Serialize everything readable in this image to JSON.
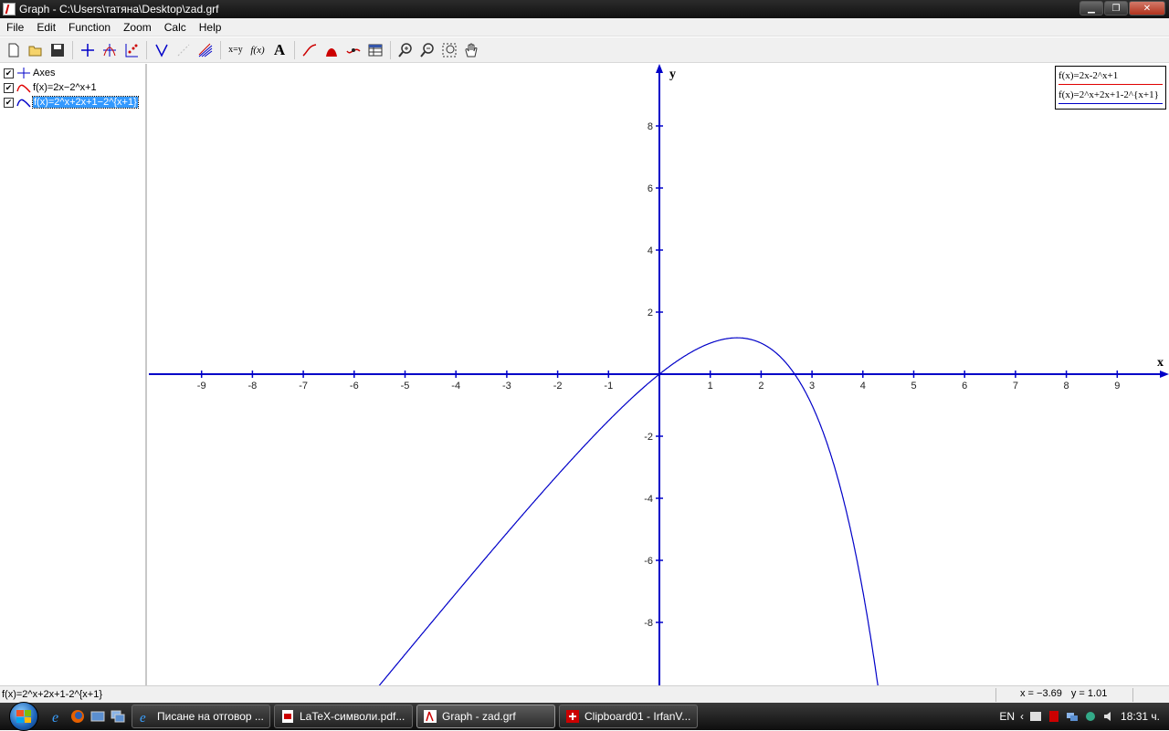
{
  "window": {
    "title": "Graph - C:\\Users\\татяна\\Desktop\\zad.grf",
    "buttons": [
      "minimize",
      "maximize",
      "close"
    ]
  },
  "menu": [
    "File",
    "Edit",
    "Function",
    "Zoom",
    "Calc",
    "Help"
  ],
  "toolbar": {
    "groups": [
      [
        "new-file-icon",
        "open-folder-icon",
        "save-disk-icon"
      ],
      [
        "axes-icon",
        "insert-function-icon",
        "insert-point-series-icon"
      ],
      [
        "tangent-icon",
        "relation-icon",
        "shading-icon"
      ],
      [
        "trendline-icon",
        "insert-label-icon",
        "text-icon"
      ],
      [
        "curve-icon",
        "area-icon",
        "evaluate-icon",
        "table-icon"
      ],
      [
        "zoom-in-icon",
        "zoom-out-icon",
        "zoom-window-icon",
        "pan-hand-icon"
      ]
    ],
    "text_buttons": {
      "xy": "x=y",
      "fx": "f(x)",
      "text": "A"
    }
  },
  "sidebar": {
    "items": [
      {
        "label": "Axes",
        "checked": true,
        "icon": "axes-icon",
        "selected": false
      },
      {
        "label": "f(x)=2x−2^x+1",
        "checked": true,
        "icon": "red-curve-icon",
        "color": "#e00000",
        "selected": false
      },
      {
        "label": "f(x)=2^x+2x+1−2^{x+1}",
        "checked": true,
        "icon": "blue-curve-icon",
        "color": "#0000c8",
        "selected": true
      }
    ]
  },
  "legend": {
    "items": [
      {
        "label": "f(x)=2x-2^x+1",
        "color": "#e00000"
      },
      {
        "label": "f(x)=2^x+2x+1-2^{x+1}",
        "color": "#0000c8"
      }
    ]
  },
  "chart_data": {
    "type": "line",
    "xlabel": "x",
    "ylabel": "y",
    "xlim": [
      -10,
      10
    ],
    "ylim": [
      -10,
      10
    ],
    "x_ticks": [
      -9,
      -8,
      -7,
      -6,
      -5,
      -4,
      -3,
      -2,
      -1,
      1,
      2,
      3,
      4,
      5,
      6,
      7,
      8,
      9
    ],
    "y_ticks": [
      8,
      6,
      4,
      2,
      -2,
      -4,
      -6,
      -8
    ],
    "axis_color": "#0000c8",
    "series": [
      {
        "name": "f(x)=2^x+2x+1-2^{x+1}",
        "expression": "2x - 2^x + 1",
        "color": "#0000c8"
      }
    ]
  },
  "statusbar": {
    "function": "f(x)=2^x+2x+1-2^{x+1}",
    "x": "x = −3.69",
    "y": "y = 1.01"
  },
  "taskbar": {
    "quick_launch": [
      "ie-icon",
      "firefox-icon",
      "show-desktop-icon",
      "switch-windows-icon"
    ],
    "buttons": [
      {
        "label": "Писане на отговор ...",
        "icon": "ie-icon",
        "active": false
      },
      {
        "label": "LaTeX-символи.pdf...",
        "icon": "pdf-icon",
        "active": false
      },
      {
        "label": "Graph - zad.grf",
        "icon": "graph-app-icon",
        "active": true
      },
      {
        "label": "Clipboard01 - IrfanV...",
        "icon": "irfanview-icon",
        "active": false
      }
    ],
    "tray": {
      "lang": "EN",
      "time": "18:31 ч."
    }
  }
}
